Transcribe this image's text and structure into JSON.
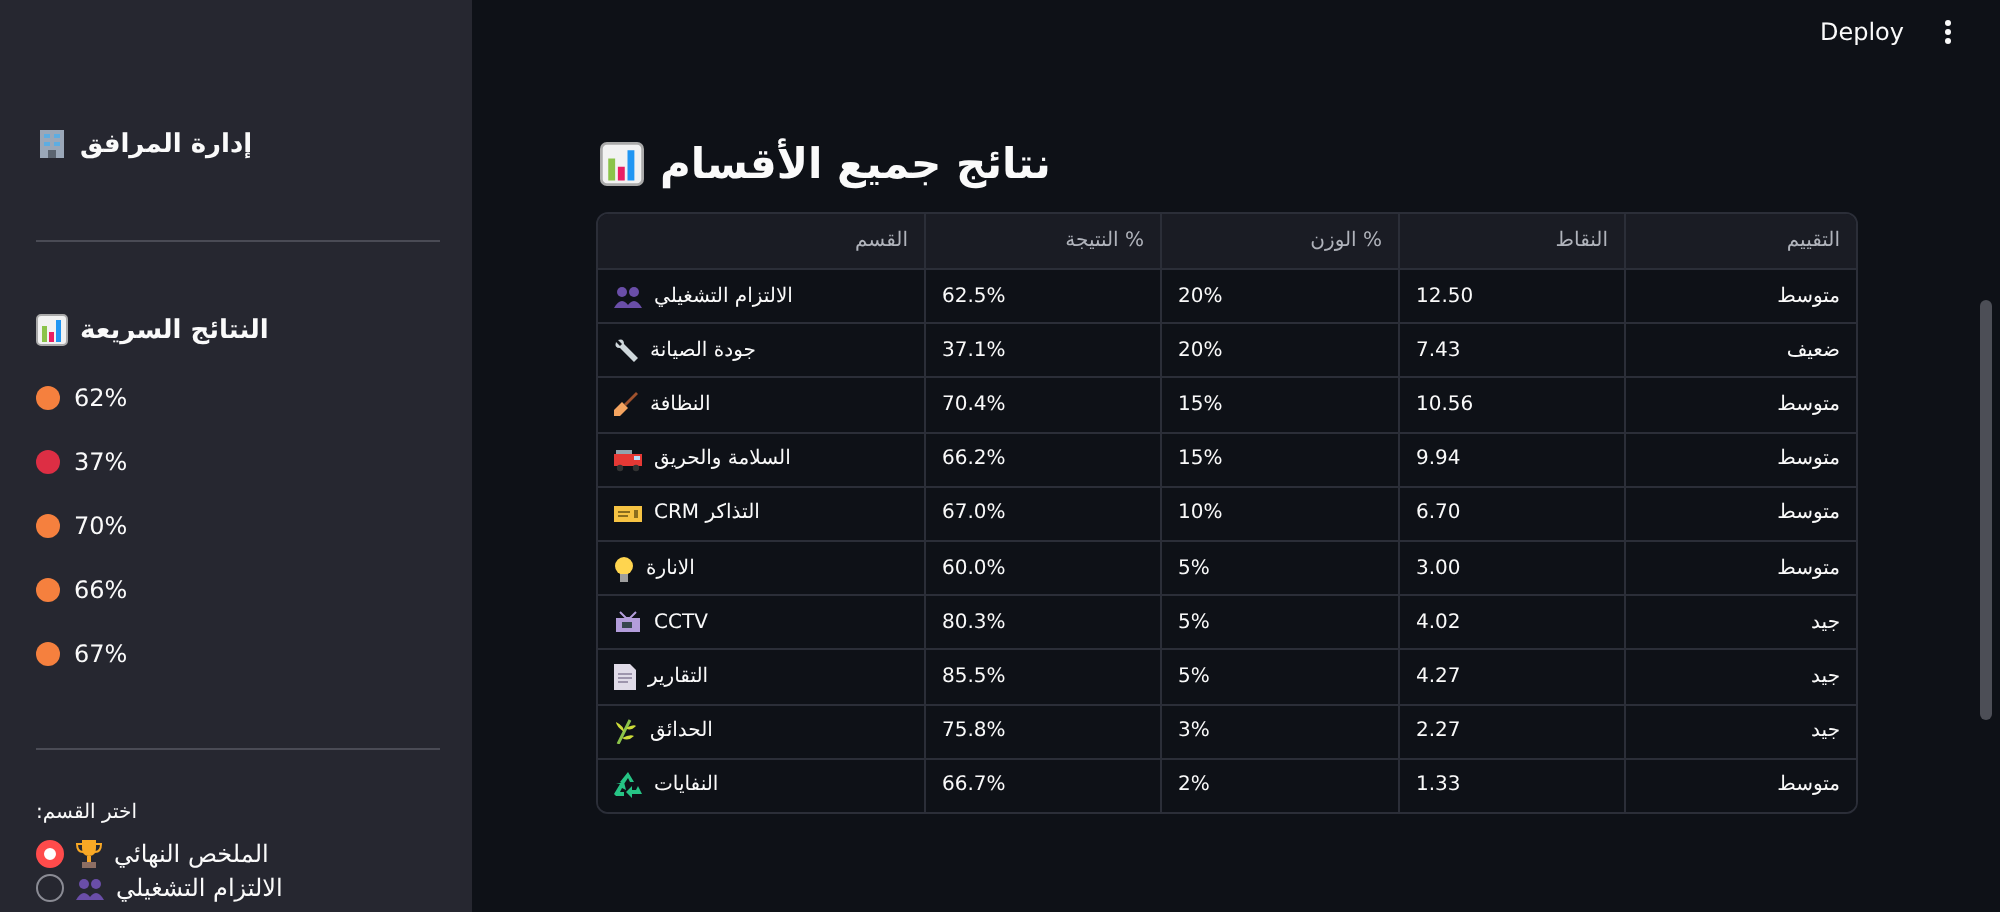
{
  "sidebar": {
    "title": "إدارة المرافق",
    "quick_results": {
      "title": "النتائج السريعة",
      "items": [
        {
          "text": "62%",
          "color": "#f5803e"
        },
        {
          "text": "37%",
          "color": "#dd2e44"
        },
        {
          "text": "70%",
          "color": "#f5803e"
        },
        {
          "text": "66%",
          "color": "#f5803e"
        },
        {
          "text": "67%",
          "color": "#f5803e"
        }
      ]
    },
    "selector": {
      "label": "اختر القسم:",
      "options": [
        {
          "label": "الملخص النهائي",
          "selected": true
        },
        {
          "label": "الالتزام التشغيلي",
          "selected": false
        }
      ]
    }
  },
  "header": {
    "deploy": "Deploy"
  },
  "main": {
    "title": "نتائج جميع الأقسام",
    "table": {
      "columns": [
        "التقييم",
        "النقاط",
        "% الوزن",
        "% النتيجة",
        "القسم"
      ],
      "rows": [
        [
          "متوسط",
          "12.50",
          "20%",
          "62.5%",
          "الالتزام التشغيلي"
        ],
        [
          "ضعيف",
          "7.43",
          "20%",
          "37.1%",
          "جودة الصيانة"
        ],
        [
          "متوسط",
          "10.56",
          "15%",
          "70.4%",
          "النظافة"
        ],
        [
          "متوسط",
          "9.94",
          "15%",
          "66.2%",
          "السلامة والحريق"
        ],
        [
          "متوسط",
          "6.70",
          "10%",
          "67.0%",
          "التذاكر CRM"
        ],
        [
          "متوسط",
          "3.00",
          "5%",
          "60.0%",
          "الانارة"
        ],
        [
          "جيد",
          "4.02",
          "5%",
          "80.3%",
          "CCTV"
        ],
        [
          "جيد",
          "4.27",
          "5%",
          "85.5%",
          "التقارير"
        ],
        [
          "جيد",
          "2.27",
          "3%",
          "75.8%",
          "الحدائق"
        ],
        [
          "متوسط",
          "1.33",
          "2%",
          "66.7%",
          "النفايات"
        ]
      ]
    }
  }
}
